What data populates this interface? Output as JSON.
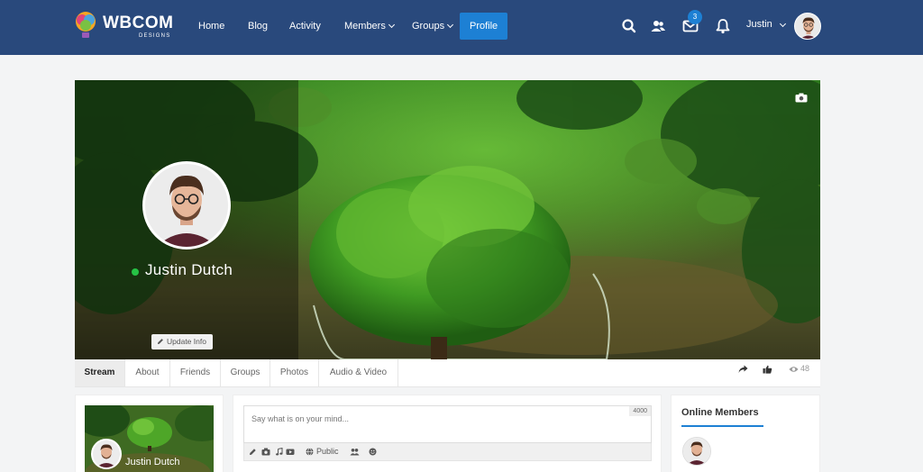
{
  "brand": {
    "name": "WBCOM",
    "sub": "DESIGNS"
  },
  "nav": [
    {
      "label": "Home"
    },
    {
      "label": "Blog"
    },
    {
      "label": "Activity"
    },
    {
      "label": "Members"
    },
    {
      "label": "Groups"
    },
    {
      "label": "Profile"
    }
  ],
  "header": {
    "messages_count": "3",
    "user_name": "Justin",
    "icons": [
      "search-icon",
      "friends-icon",
      "messages-icon",
      "notifications-icon"
    ]
  },
  "profile": {
    "name": "Justin Dutch",
    "status": "online",
    "update_label": "Update Info"
  },
  "tabs": [
    {
      "label": "Stream"
    },
    {
      "label": "About"
    },
    {
      "label": "Friends"
    },
    {
      "label": "Groups"
    },
    {
      "label": "Photos"
    },
    {
      "label": "Audio & Video"
    }
  ],
  "tab_actions": {
    "views": "48",
    "icons": [
      "share-icon",
      "like-icon",
      "eye-icon"
    ]
  },
  "composer": {
    "placeholder": "Say what is on your mind...",
    "counter": "4000",
    "privacy": "Public"
  },
  "mini_card": {
    "name": "Justin Dutch"
  },
  "online_members": {
    "title": "Online Members"
  },
  "colors": {
    "header_bg": "#29497c",
    "accent": "#1d80d4",
    "online": "#26c245"
  }
}
